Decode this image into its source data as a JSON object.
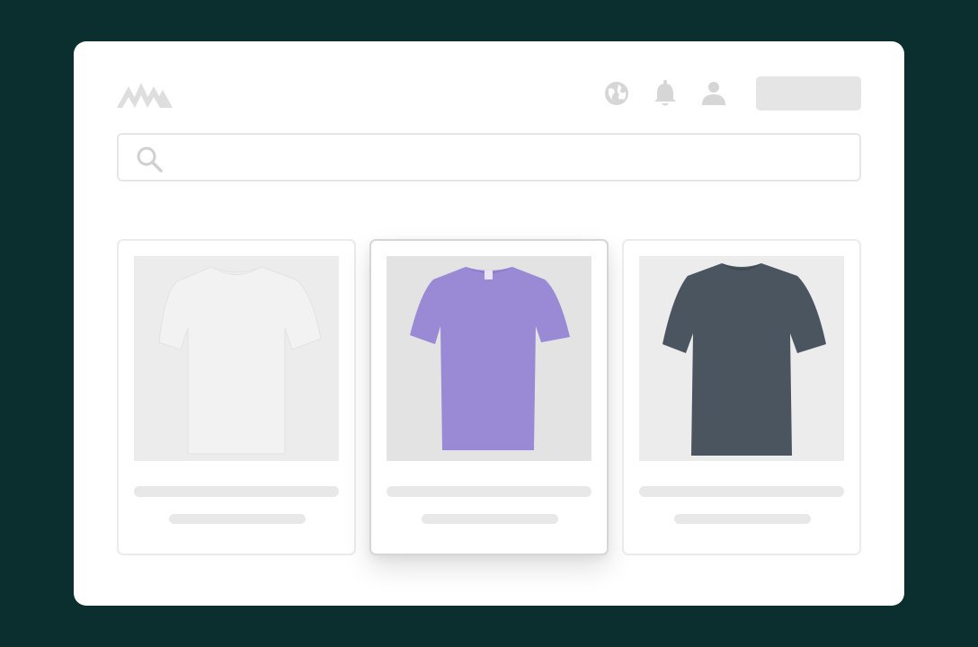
{
  "app": {
    "logo": "brand-logo"
  },
  "header": {
    "icons": [
      "globe-icon",
      "bell-icon",
      "user-icon"
    ],
    "button_label": ""
  },
  "search": {
    "value": "",
    "placeholder": "",
    "icon": "search-icon"
  },
  "products": [
    {
      "color": "#f0f0f0",
      "title": "",
      "subtitle": "",
      "selected": false
    },
    {
      "color": "#9a8ad6",
      "title": "",
      "subtitle": "",
      "selected": true
    },
    {
      "color": "#4a5560",
      "title": "",
      "subtitle": "",
      "selected": false
    }
  ],
  "colors": {
    "background": "#0b2e2e",
    "window": "#ffffff",
    "placeholder": "#e8e8e8",
    "icon": "#d9d9d9"
  }
}
